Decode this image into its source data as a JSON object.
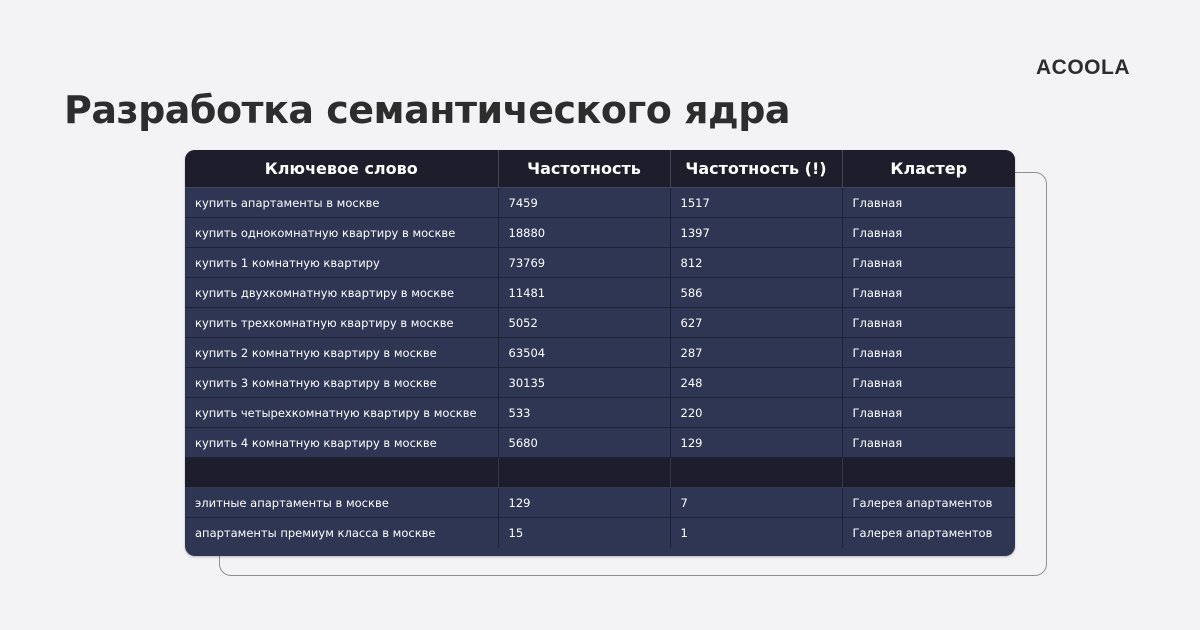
{
  "logo": {
    "text": "ACOOLA"
  },
  "page_title": "Разработка семантического ядра",
  "table": {
    "headers": [
      "Ключевое слово",
      "Частотность",
      "Частотность (!)",
      "Кластер"
    ],
    "rows": [
      [
        "купить апартаменты в москве",
        "7459",
        "1517",
        "Главная"
      ],
      [
        "купить однокомнатную квартиру в москве",
        "18880",
        "1397",
        "Главная"
      ],
      [
        "купить 1 комнатную квартиру",
        "73769",
        "812",
        "Главная"
      ],
      [
        "купить двухкомнатную квартиру в москве",
        "11481",
        "586",
        "Главная"
      ],
      [
        "купить трехкомнатную квартиру в москве",
        "5052",
        "627",
        "Главная"
      ],
      [
        "купить 2 комнатную квартиру в москве",
        "63504",
        "287",
        "Главная"
      ],
      [
        "купить 3 комнатную квартиру в москве",
        "30135",
        "248",
        "Главная"
      ],
      [
        "купить четырехкомнатную квартиру в москве",
        "533",
        "220",
        "Главная"
      ],
      [
        "купить 4 комнатную квартиру в москве",
        "5680",
        "129",
        "Главная"
      ],
      [
        "",
        "",
        "",
        ""
      ],
      [
        "элитные апартаменты в москве",
        "129",
        "7",
        "Галерея апартаментов"
      ],
      [
        "апартаменты премиум класса в москве",
        "15",
        "1",
        "Галерея апартаментов"
      ]
    ]
  },
  "colors": {
    "background": "#f3f3f5",
    "title_text": "#2d2d2d",
    "header_bg": "#1d1d2b",
    "row_bg": "#2e3653",
    "separator_bg": "#1d1d2b",
    "cell_text": "#ffffff",
    "frame_outline": "#8e8e96"
  }
}
